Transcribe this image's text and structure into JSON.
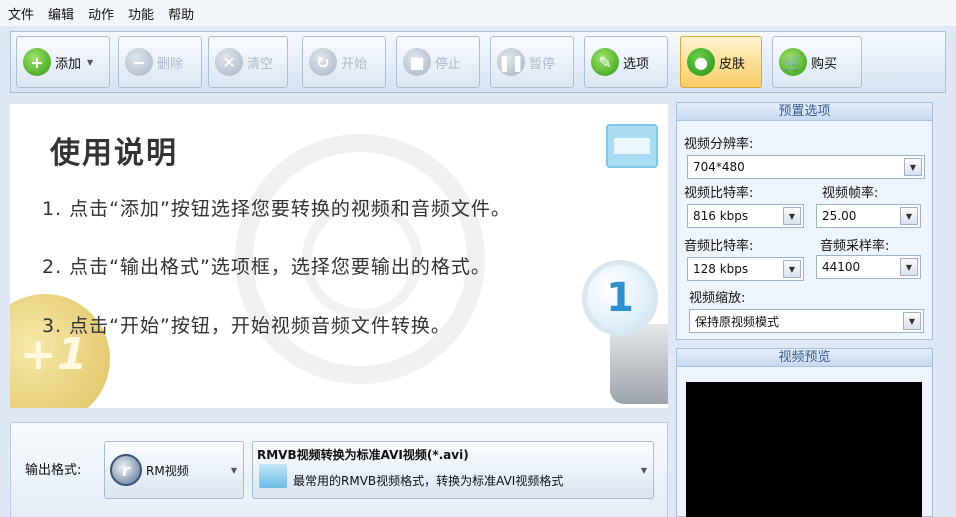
{
  "menu": [
    "文件",
    "编辑",
    "动作",
    "功能",
    "帮助"
  ],
  "toolbar": {
    "add": "添加",
    "delete": "删除",
    "clear": "清空",
    "start": "开始",
    "stop": "停止",
    "pause": "暂停",
    "options": "选项",
    "skin": "皮肤",
    "buy": "购买"
  },
  "instructions": {
    "title": "使用说明",
    "lines": [
      "1. 点击“添加”按钮选择您要转换的视频和音频文件。",
      "2. 点击“输出格式”选项框，选择您要输出的格式。",
      "3. 点击“开始”按钮，开始视频音频文件转换。"
    ],
    "badge": "1",
    "coin_text": "+1"
  },
  "output": {
    "label": "输出格式:",
    "format_label": "RM视频",
    "format_icon_letter": "r",
    "subformat_title": "RMVB视频转换为标准AVI视频(*.avi)",
    "subformat_desc": "最常用的RMVB视频格式，转换为标准AVI视频格式"
  },
  "preset": {
    "header": "预置选项",
    "resolution_label": "视频分辨率:",
    "resolution_value": "704*480",
    "video_bitrate_label": "视频比特率:",
    "video_bitrate_value": "816 kbps",
    "framerate_label": "视频帧率:",
    "framerate_value": "25.00",
    "audio_bitrate_label": "音频比特率:",
    "audio_bitrate_value": "128 kbps",
    "samplerate_label": "音频采样率:",
    "samplerate_value": "44100",
    "scaling_label": "视频缩放:",
    "scaling_value": "保持原视频模式"
  },
  "preview": {
    "header": "视频预览"
  }
}
